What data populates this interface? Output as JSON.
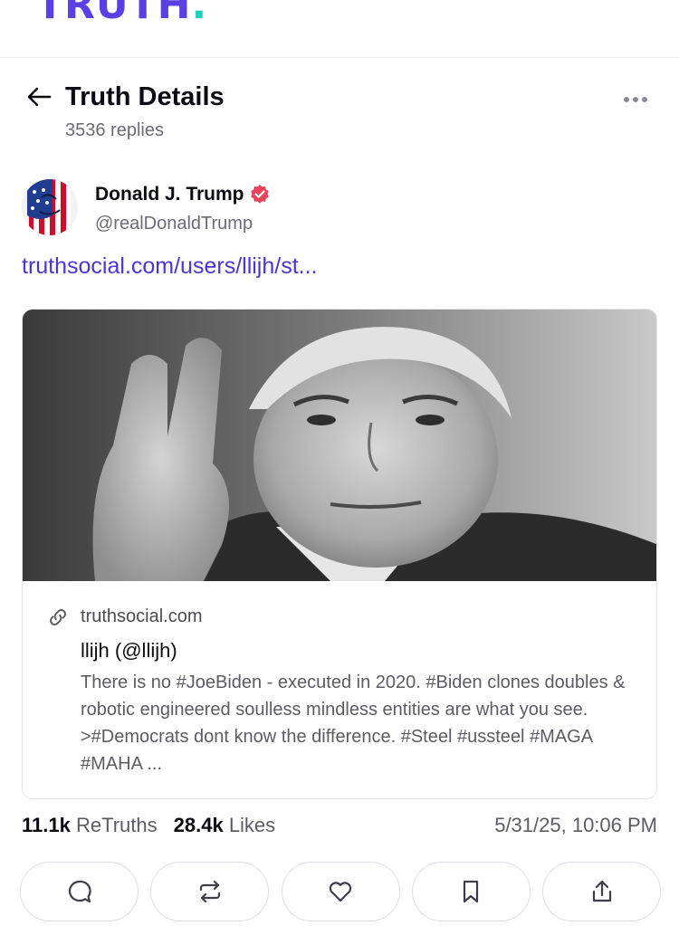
{
  "app": {
    "logo_text": "TRUTH",
    "logo_dot": "."
  },
  "header": {
    "title": "Truth Details",
    "subtitle": "3536 replies"
  },
  "post": {
    "author": {
      "name": "Donald J. Trump",
      "handle": "@realDonaldTrump",
      "verified": true
    },
    "link_text": "truthsocial.com/users/llijh/st...",
    "preview": {
      "domain": "truthsocial.com",
      "title": "llijh (@llijh)",
      "description": "There is no #JoeBiden - executed in 2020. #Biden clones doubles & robotic engineered soulless mindless entities are what you see. >#Democrats dont know the difference. #Steel #ussteel #MAGA #MAHA ..."
    },
    "stats": {
      "retruths_count": "11.1k",
      "retruths_label": "ReTruths",
      "likes_count": "28.4k",
      "likes_label": "Likes"
    },
    "timestamp": "5/31/25, 10:06 PM"
  },
  "actions": [
    {
      "icon": "reply-icon"
    },
    {
      "icon": "retruth-icon"
    },
    {
      "icon": "like-icon"
    },
    {
      "icon": "bookmark-icon"
    },
    {
      "icon": "share-icon"
    }
  ],
  "colors": {
    "brand": "#5b3fe6",
    "brand_dot": "#19d1c0",
    "link": "#4a35d6",
    "verified": "#e8435d"
  }
}
